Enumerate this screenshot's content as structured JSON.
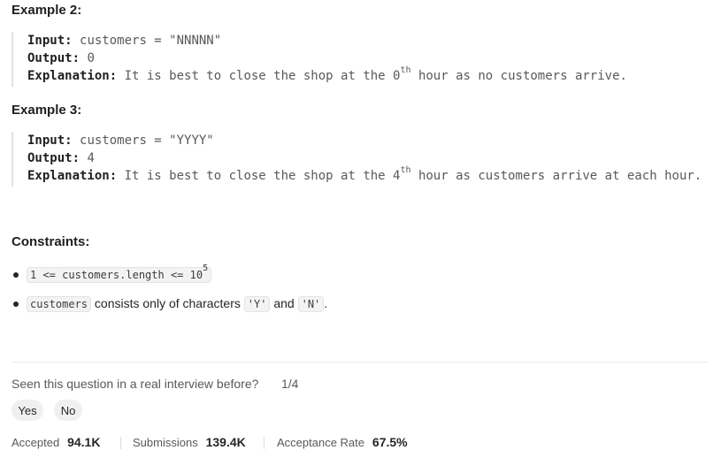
{
  "example2": {
    "heading": "Example 2:",
    "input_label": "Input:",
    "input_value": "customers = \"NNNNN\"",
    "output_label": "Output:",
    "output_value": "0",
    "explanation_label": "Explanation:",
    "explanation_pre": "It is best to close the shop at the 0",
    "explanation_sup": "th",
    "explanation_post": " hour as no customers arrive."
  },
  "example3": {
    "heading": "Example 3:",
    "input_label": "Input:",
    "input_value": "customers = \"YYYY\"",
    "output_label": "Output:",
    "output_value": "4",
    "explanation_label": "Explanation:",
    "explanation_pre": "It is best to close the shop at the 4",
    "explanation_sup": "th",
    "explanation_post": " hour as customers arrive at each hour."
  },
  "constraints": {
    "heading": "Constraints:",
    "item1_code": "1 <= customers.length <= 10",
    "item1_sup": "5",
    "item2_code": "customers",
    "item2_text1": " consists only of characters ",
    "item2_code2": "'Y'",
    "item2_text2": " and ",
    "item2_code3": "'N'",
    "item2_text3": "."
  },
  "feedback": {
    "question": "Seen this question in a real interview before?",
    "counter": "1/4",
    "yes_label": "Yes",
    "no_label": "No"
  },
  "stats": {
    "accepted_label": "Accepted",
    "accepted_value": "94.1K",
    "submissions_label": "Submissions",
    "submissions_value": "139.4K",
    "rate_label": "Acceptance Rate",
    "rate_value": "67.5%"
  }
}
